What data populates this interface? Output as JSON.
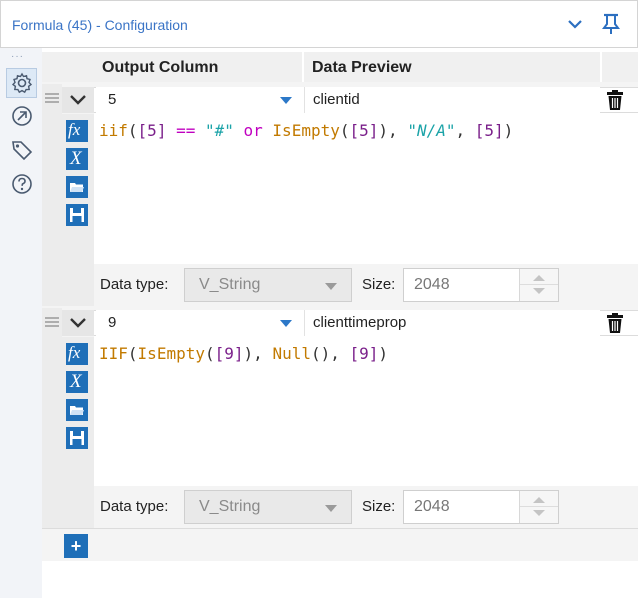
{
  "window": {
    "title": "Formula (45) - Configuration"
  },
  "grid": {
    "headers": {
      "output_column": "Output Column",
      "data_preview": "Data Preview"
    },
    "rows": [
      {
        "output": "5",
        "preview": "clientid",
        "expression_tokens": [
          {
            "t": "iif",
            "c": "fn"
          },
          {
            "t": "(",
            "c": "p"
          },
          {
            "t": "[5]",
            "c": "br"
          },
          {
            "t": " == ",
            "c": "op"
          },
          {
            "t": "\"#\"",
            "c": "str"
          },
          {
            "t": " or ",
            "c": "kw"
          },
          {
            "t": "IsEmpty",
            "c": "fn"
          },
          {
            "t": "(",
            "c": "p"
          },
          {
            "t": "[5]",
            "c": "br"
          },
          {
            "t": "), ",
            "c": "p"
          },
          {
            "t": "\"N/A\"",
            "c": "str"
          },
          {
            "t": ", ",
            "c": "p"
          },
          {
            "t": "[5]",
            "c": "br"
          },
          {
            "t": ")",
            "c": "p"
          }
        ],
        "data_type_label": "Data type:",
        "data_type": "V_String",
        "size_label": "Size:",
        "size": "2048"
      },
      {
        "output": "9",
        "preview": "clienttimeprop",
        "expression_tokens": [
          {
            "t": "IIF",
            "c": "fn"
          },
          {
            "t": "(",
            "c": "p"
          },
          {
            "t": "IsEmpty",
            "c": "fn"
          },
          {
            "t": "(",
            "c": "p"
          },
          {
            "t": "[9]",
            "c": "br"
          },
          {
            "t": "), ",
            "c": "p"
          },
          {
            "t": "Null",
            "c": "fn"
          },
          {
            "t": "(), ",
            "c": "p"
          },
          {
            "t": "[9]",
            "c": "br"
          },
          {
            "t": ")",
            "c": "p"
          }
        ],
        "data_type_label": "Data type:",
        "data_type": "V_String",
        "size_label": "Size:",
        "size": "2048"
      }
    ],
    "add_label": "+"
  },
  "icons": {
    "title": [
      "chevron-down-icon",
      "pin-icon"
    ],
    "sidebar": [
      "gear-icon",
      "arrow-icon",
      "tag-icon",
      "help-icon"
    ],
    "tools": [
      "fx-icon",
      "variable-x-icon",
      "folder-open-icon",
      "save-icon"
    ]
  },
  "colors": {
    "accent": "#1f6fb8",
    "title": "#3a74c6",
    "function": "#c27a00",
    "field": "#7a1f8a",
    "string": "#1ba3a8"
  }
}
